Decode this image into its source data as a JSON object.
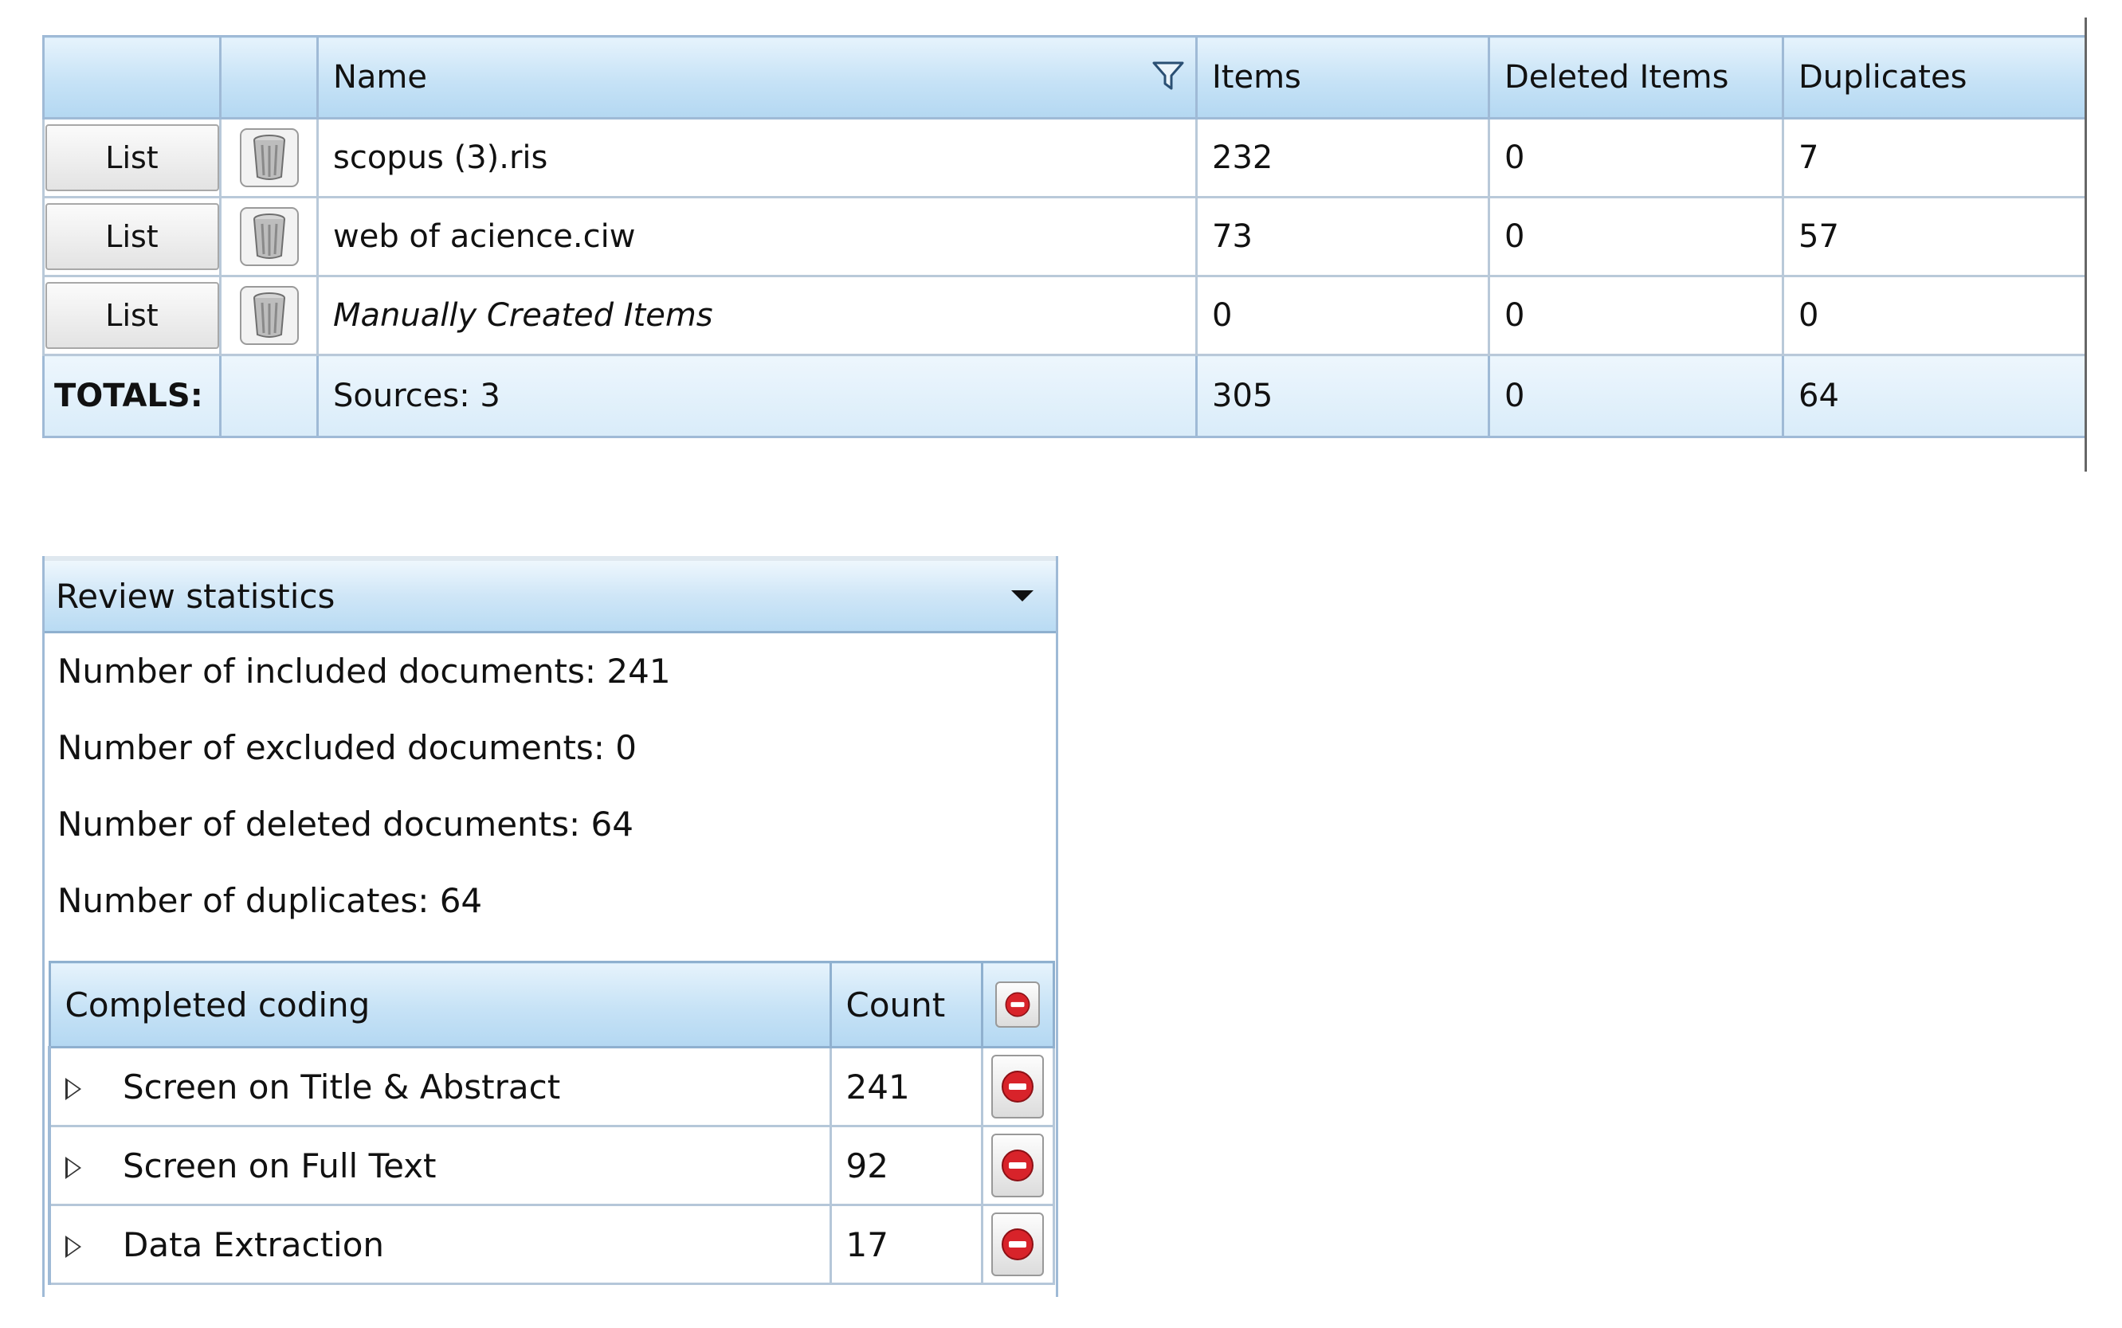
{
  "sources_table": {
    "columns": [
      "",
      "",
      "Name",
      "Items",
      "Deleted Items",
      "Duplicates"
    ],
    "rows": [
      {
        "button": "List",
        "name": "scopus (3).ris",
        "italic": false,
        "items": "232",
        "deleted": "0",
        "duplicates": "7"
      },
      {
        "button": "List",
        "name": "web of acience.ciw",
        "italic": false,
        "items": "73",
        "deleted": "0",
        "duplicates": "57"
      },
      {
        "button": "List",
        "name": "Manually Created Items",
        "italic": true,
        "items": "0",
        "deleted": "0",
        "duplicates": "0"
      }
    ],
    "totals": {
      "label": "TOTALS:",
      "sources": "Sources: 3",
      "items": "305",
      "deleted": "0",
      "duplicates": "64"
    },
    "icons": {
      "filter": "filter-icon",
      "row": "trash-bin-icon"
    }
  },
  "review_panel": {
    "title": "Review statistics",
    "stats": [
      "Number of included documents: 241",
      "Number of excluded documents: 0",
      "Number of deleted documents: 64",
      "Number of duplicates: 64"
    ],
    "coding_table": {
      "header": {
        "name": "Completed coding",
        "count": "Count"
      },
      "rows": [
        {
          "name": "Screen on Title & Abstract",
          "count": "241"
        },
        {
          "name": "Screen on Full Text",
          "count": "92"
        },
        {
          "name": "Data Extraction",
          "count": "17"
        }
      ]
    }
  },
  "colors": {
    "header_blue": "#c6e2f6",
    "border": "#9fbad6",
    "delete_red": "#d8232a"
  }
}
